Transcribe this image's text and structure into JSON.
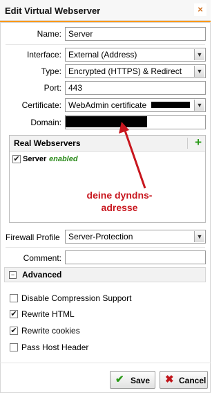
{
  "dialog": {
    "title": "Edit Virtual Webserver",
    "close_symbol": "×"
  },
  "form": {
    "name_label": "Name:",
    "name_value": "Server",
    "interface_label": "Interface:",
    "interface_value": "External (Address)",
    "type_label": "Type:",
    "type_value": "Encrypted (HTTPS) & Redirect",
    "port_label": "Port:",
    "port_value": "443",
    "certificate_label": "Certificate:",
    "certificate_value": "WebAdmin certificate",
    "domain_label": "Domain:"
  },
  "real_webservers": {
    "title": "Real Webservers",
    "add_symbol": "+",
    "items": [
      {
        "name": "Server",
        "status": "enabled",
        "checked": true
      }
    ]
  },
  "annotation": {
    "line1": "deine dyndns-",
    "line2": "adresse",
    "color": "#c8161e"
  },
  "firewall": {
    "label": "Firewall Profile",
    "value": "Server-Protection"
  },
  "comment": {
    "label": "Comment:",
    "value": ""
  },
  "advanced": {
    "title": "Advanced",
    "collapse_symbol": "−",
    "options": [
      {
        "label": "Disable Compression Support",
        "checked": false
      },
      {
        "label": "Rewrite HTML",
        "checked": true
      },
      {
        "label": "Rewrite cookies",
        "checked": true
      },
      {
        "label": "Pass Host Header",
        "checked": false
      }
    ]
  },
  "buttons": {
    "save": "Save",
    "cancel": "Cancel",
    "save_icon": "✔",
    "cancel_icon": "✖"
  },
  "colors": {
    "accent": "#ff9a1a",
    "enabled_green": "#2a8a1a",
    "add_green": "#2a9a18",
    "cancel_red": "#c0141a"
  }
}
